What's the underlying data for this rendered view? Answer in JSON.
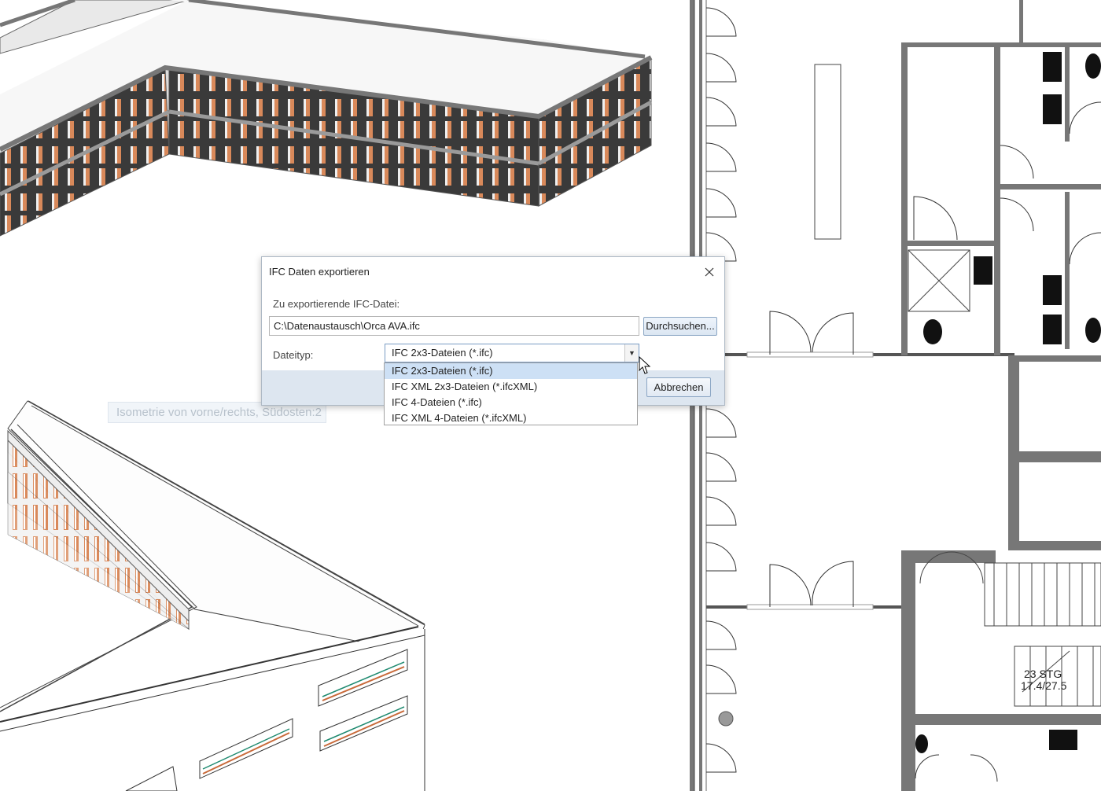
{
  "viewport": {
    "label": "Isometrie von vorne/rechts, Südosten:2"
  },
  "dialog": {
    "title": "IFC Daten exportieren",
    "file_label": "Zu exportierende IFC-Datei:",
    "file_path": "C:\\Datenaustausch\\Orca AVA.ifc",
    "browse_label": "Durchsuchen...",
    "type_label": "Dateityp:",
    "type_selected": "IFC 2x3-Dateien (*.ifc)",
    "options": [
      "IFC 2x3-Dateien (*.ifc)",
      "IFC XML 2x3-Dateien (*.ifcXML)",
      "IFC 4-Dateien (*.ifc)",
      "IFC XML 4-Dateien (*.ifcXML)"
    ],
    "cancel_label": "Abbrechen"
  },
  "floor_plan": {
    "stair_label_1": "23 STG",
    "stair_label_2": "17.4/27.5"
  },
  "colors": {
    "wall": "#707070",
    "window_orange": "#d9895a",
    "dialog_footer": "#dde6f0",
    "selection": "#cde0f5"
  },
  "icons": [
    "close-icon",
    "dropdown-arrow-icon",
    "mouse-cursor-icon",
    "door-swing-icon"
  ]
}
